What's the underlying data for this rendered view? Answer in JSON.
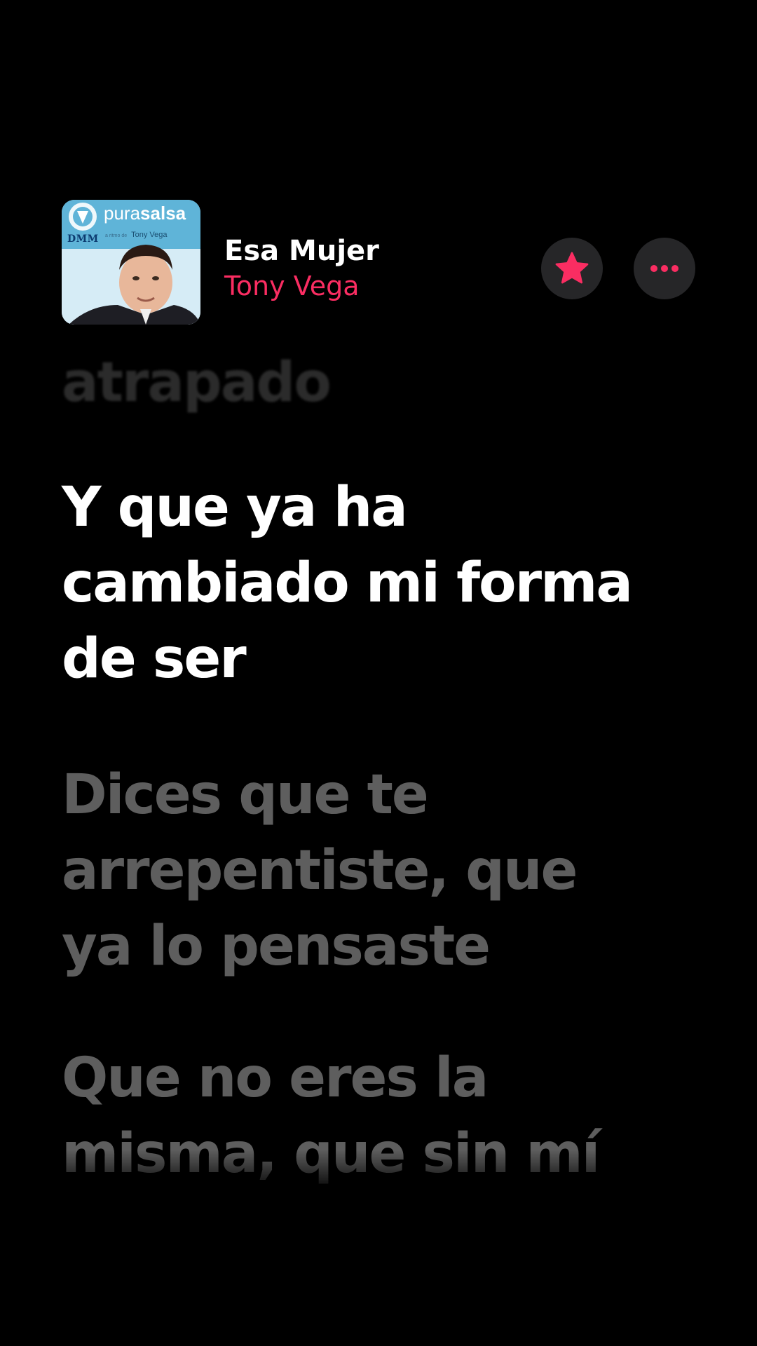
{
  "album_art": {
    "brand_prefix": "pura",
    "brand_suffix": "salsa",
    "subtitle_small": "a ritmo de",
    "subtitle_artist": "Tony Vega",
    "logo": "DMM"
  },
  "now_playing": {
    "title": "Esa Mujer",
    "artist": "Tony Vega"
  },
  "controls": {
    "favorite_icon": "star-icon",
    "more_icon": "ellipsis-icon",
    "accent_color": "#fa2d62"
  },
  "lyrics": {
    "previous": [
      "atrapado"
    ],
    "active": [
      "Y que ya ha",
      "cambiado mi forma",
      "de ser"
    ],
    "next_1": [
      "Dices que te",
      "arrepentiste, que",
      "ya lo pensaste"
    ],
    "next_2": [
      "Que no eres la",
      "misma, que sin mí"
    ]
  }
}
